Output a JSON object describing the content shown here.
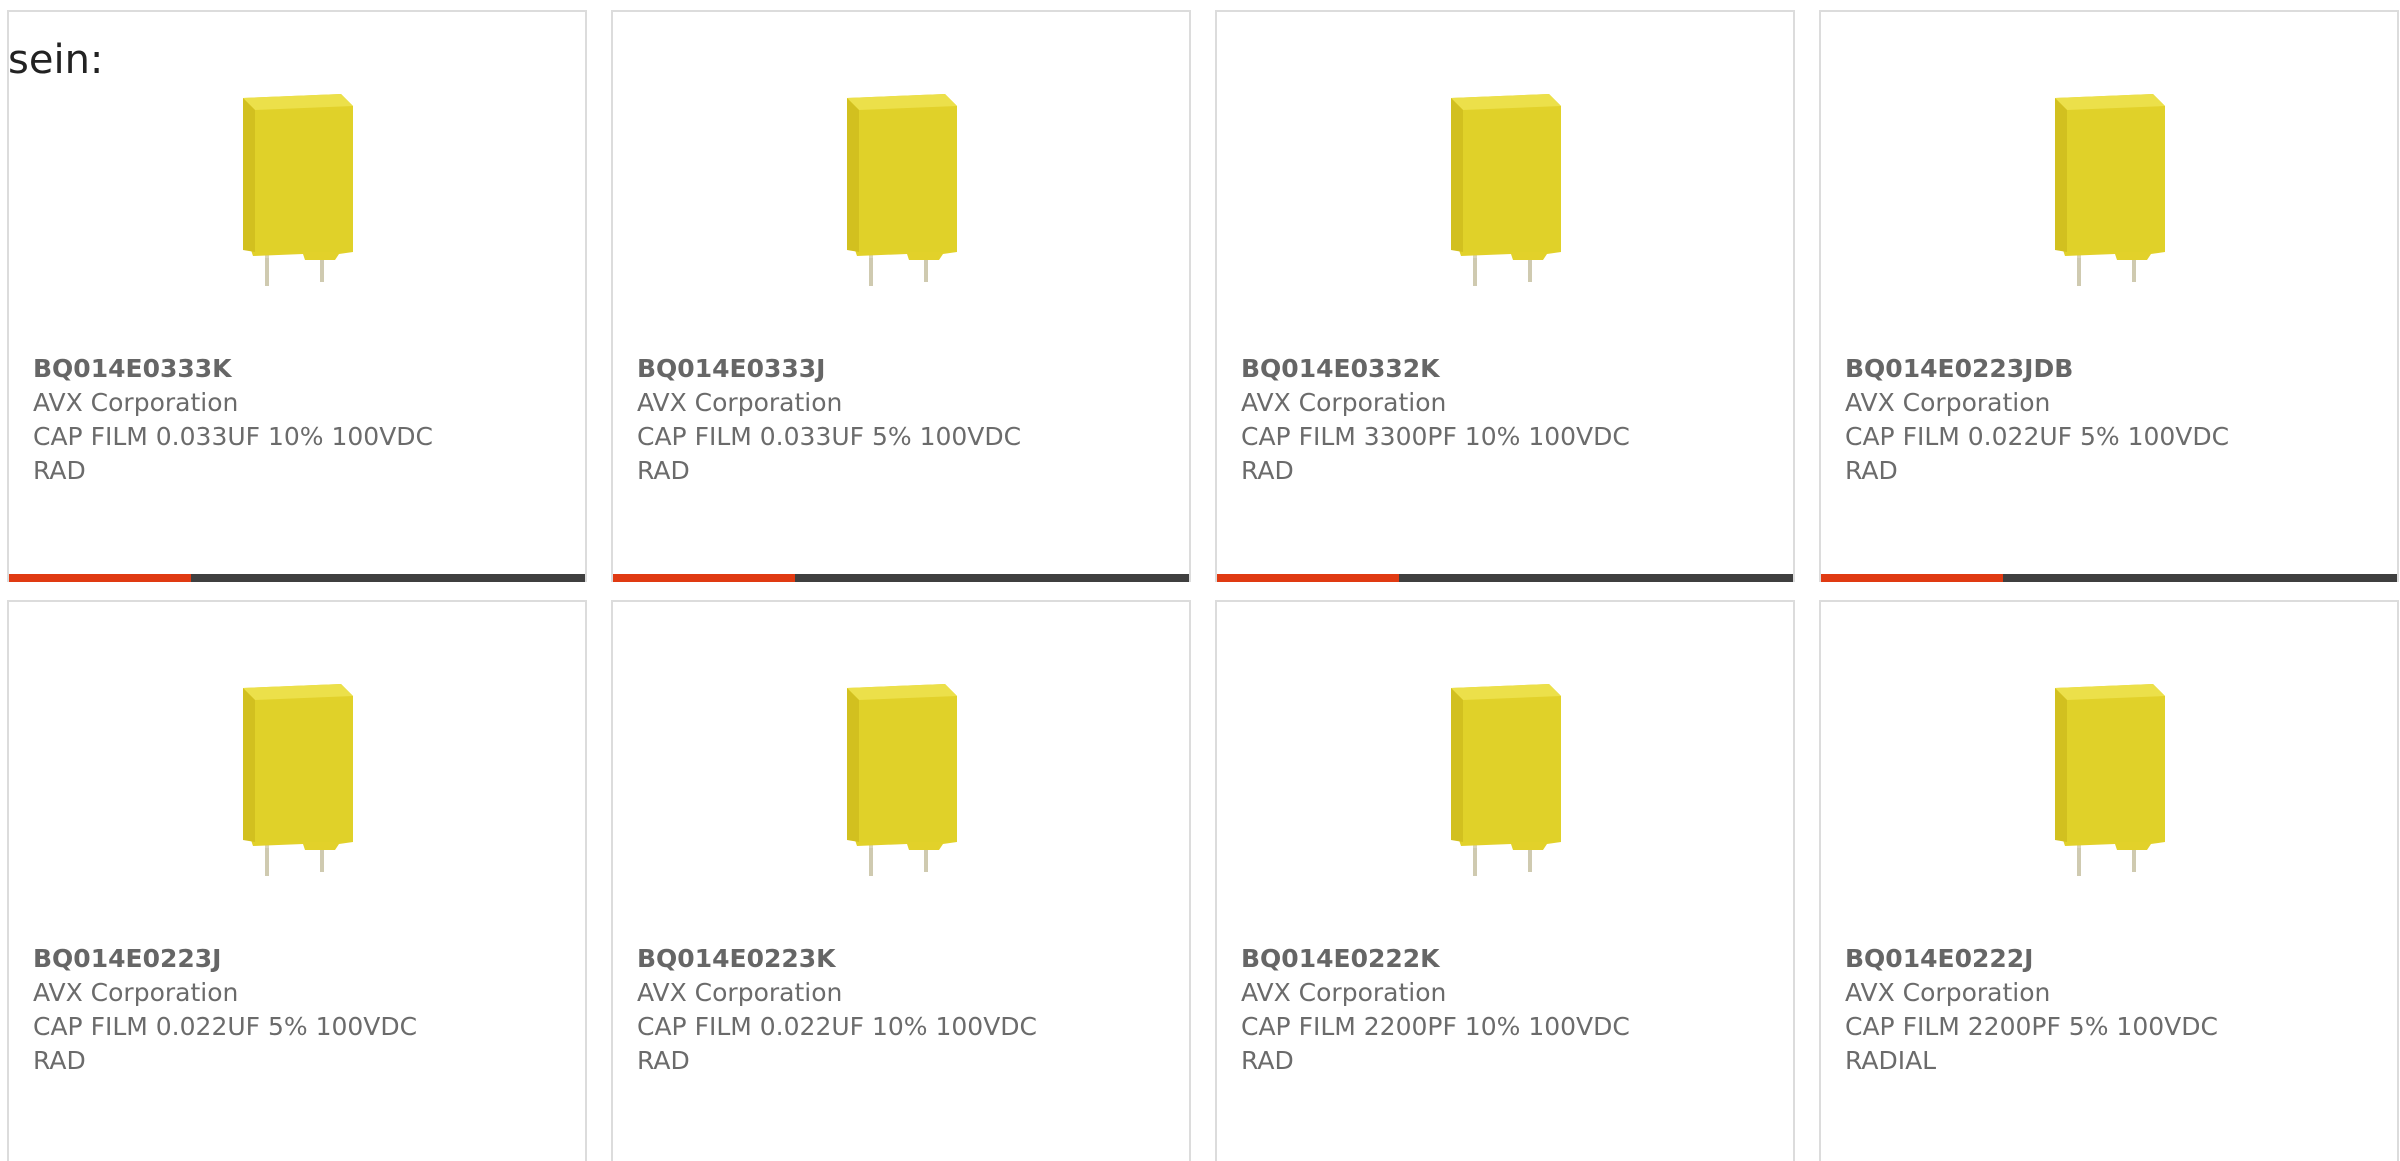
{
  "intro_text": "sein:",
  "colors": {
    "accent": "#e03a12",
    "bar": "#3f3f3f",
    "capacitor_body": "#e2d12a"
  },
  "products": [
    {
      "part_number": "BQ014E0333K",
      "manufacturer": "AVX Corporation",
      "description": "CAP FILM 0.033UF 10% 100VDC RAD",
      "image_icon": "film-capacitor-icon"
    },
    {
      "part_number": "BQ014E0333J",
      "manufacturer": "AVX Corporation",
      "description": "CAP FILM 0.033UF 5% 100VDC RAD",
      "image_icon": "film-capacitor-icon"
    },
    {
      "part_number": "BQ014E0332K",
      "manufacturer": "AVX Corporation",
      "description": "CAP FILM 3300PF 10% 100VDC RAD",
      "image_icon": "film-capacitor-icon"
    },
    {
      "part_number": "BQ014E0223JDB",
      "manufacturer": "AVX Corporation",
      "description": "CAP FILM 0.022UF 5% 100VDC RAD",
      "image_icon": "film-capacitor-icon"
    },
    {
      "part_number": "BQ014E0223J",
      "manufacturer": "AVX Corporation",
      "description": "CAP FILM 0.022UF 5% 100VDC RAD",
      "image_icon": "film-capacitor-icon"
    },
    {
      "part_number": "BQ014E0223K",
      "manufacturer": "AVX Corporation",
      "description": "CAP FILM 0.022UF 10% 100VDC RAD",
      "image_icon": "film-capacitor-icon"
    },
    {
      "part_number": "BQ014E0222K",
      "manufacturer": "AVX Corporation",
      "description": "CAP FILM 2200PF 10% 100VDC RAD",
      "image_icon": "film-capacitor-icon"
    },
    {
      "part_number": "BQ014E0222J",
      "manufacturer": "AVX Corporation",
      "description": "CAP FILM 2200PF 5% 100VDC RADIAL",
      "image_icon": "film-capacitor-icon"
    }
  ]
}
